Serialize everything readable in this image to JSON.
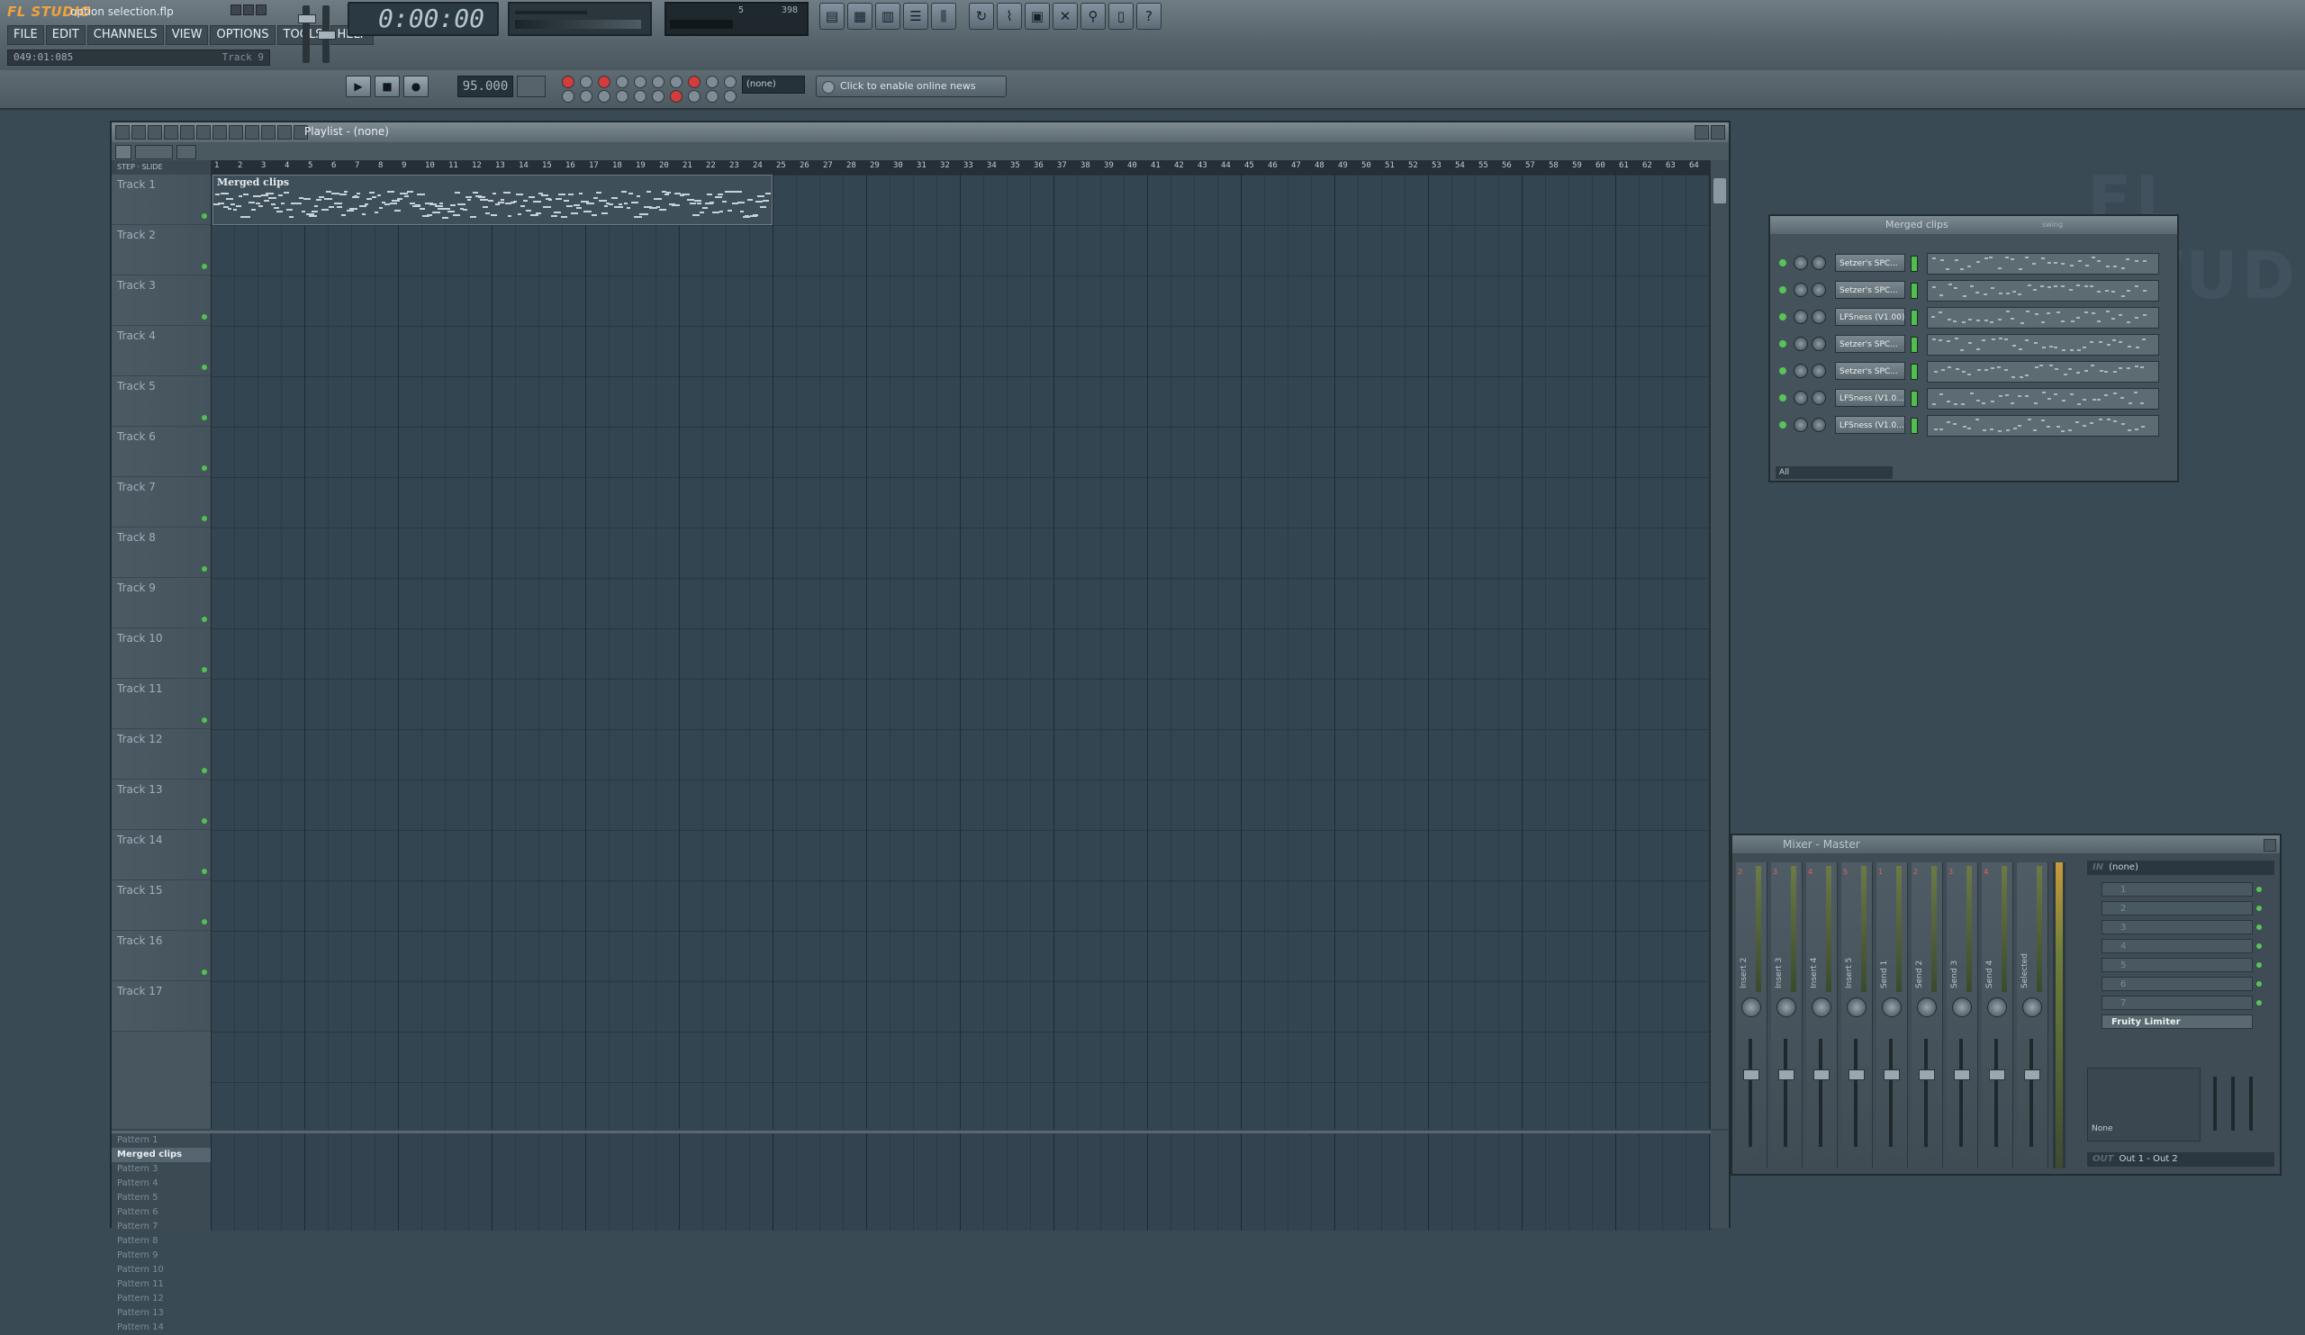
{
  "app": {
    "logo": "FL STUDIO",
    "song_file": "option selection.flp",
    "watermark": "FL STUD"
  },
  "menu": [
    "FILE",
    "EDIT",
    "CHANNELS",
    "VIEW",
    "OPTIONS",
    "TOOLS",
    "HELP"
  ],
  "hint": {
    "position": "049:01:085",
    "track": "Track 9"
  },
  "transport": {
    "time": "0:00:00",
    "bpm": "95.000",
    "pattern": "(none)",
    "cpu": "5",
    "mem": "398"
  },
  "news": {
    "label": "Click to enable online news"
  },
  "playlist": {
    "title": "Playlist - (none)",
    "step_label": "STEP · SLIDE",
    "ruler": [
      "1",
      "2",
      "3",
      "4",
      "5",
      "6",
      "7",
      "8",
      "9",
      "10",
      "11",
      "12",
      "13",
      "14",
      "15",
      "16",
      "17",
      "18",
      "19",
      "20",
      "21",
      "22",
      "23",
      "24",
      "25",
      "26",
      "27",
      "28",
      "29",
      "30",
      "31",
      "32",
      "33",
      "34",
      "35",
      "36",
      "37",
      "38",
      "39",
      "40",
      "41",
      "42",
      "43",
      "44",
      "45",
      "46",
      "47",
      "48",
      "49",
      "50",
      "51",
      "52",
      "53",
      "54",
      "55",
      "56",
      "57",
      "58",
      "59",
      "60",
      "61",
      "62",
      "63",
      "64"
    ],
    "tracks": [
      "Track 1",
      "Track 2",
      "Track 3",
      "Track 4",
      "Track 5",
      "Track 6",
      "Track 7",
      "Track 8",
      "Track 9",
      "Track 10",
      "Track 11",
      "Track 12",
      "Track 13",
      "Track 14",
      "Track 15",
      "Track 16",
      "Track 17"
    ],
    "clip": {
      "label": "Merged clips"
    },
    "patterns": [
      "Pattern 1",
      "Merged clips",
      "Pattern 3",
      "Pattern 4",
      "Pattern 5",
      "Pattern 6",
      "Pattern 7",
      "Pattern 8",
      "Pattern 9",
      "Pattern 10",
      "Pattern 11",
      "Pattern 12",
      "Pattern 13",
      "Pattern 14"
    ],
    "selected_pattern": 1
  },
  "channel_rack": {
    "title": "Merged clips",
    "swing_label": "swing",
    "channels": [
      "Setzer's SPC...",
      "Setzer's SPC...",
      "LFSness (V1.00)",
      "Setzer's SPC...",
      "Setzer's SPC...",
      "LFSness (V1.0...",
      "LFSness (V1.0..."
    ],
    "filter": "All"
  },
  "mixer": {
    "title": "Mixer - Master",
    "strips": [
      "Insert 2",
      "Insert 3",
      "Insert 4",
      "Insert 5",
      "Send 1",
      "Send 2",
      "Send 3",
      "Send 4",
      "Selected"
    ],
    "strip_numbers": [
      "2",
      "3",
      "4",
      "5",
      "1",
      "2",
      "3",
      "4",
      ""
    ],
    "in_label": "IN",
    "in_value": "(none)",
    "slots": [
      "1",
      "2",
      "3",
      "4",
      "5",
      "6",
      "7"
    ],
    "active_slot": "Fruity Limiter",
    "eq_none": "None",
    "out_label": "OUT",
    "out_value": "Out 1 - Out 2"
  }
}
